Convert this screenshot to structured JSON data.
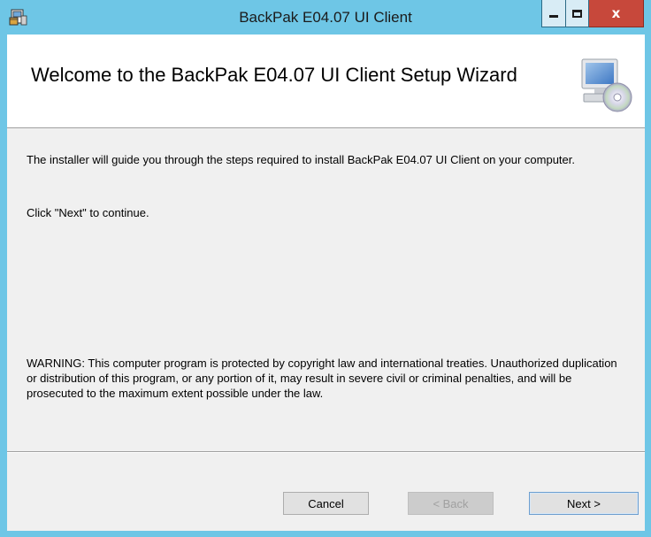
{
  "window": {
    "title": "BackPak E04.07 UI Client",
    "controls": {
      "close_glyph": "x"
    }
  },
  "banner": {
    "title": "Welcome to the BackPak E04.07 UI Client Setup Wizard",
    "icon": "computer-cd-icon"
  },
  "content": {
    "intro": "The installer will guide you through the steps required to install BackPak E04.07 UI Client on your computer.",
    "click_next": "Click \"Next\" to continue.",
    "warning": "WARNING: This computer program is protected by copyright law and international treaties. Unauthorized duplication or distribution of this program, or any portion of it, may result in severe civil or criminal penalties, and will be prosecuted to the maximum extent possible under the law."
  },
  "buttons": {
    "cancel": "Cancel",
    "back": "< Back",
    "next": "Next >"
  },
  "colors": {
    "titlebar": "#6ec6e6",
    "close_button": "#c7483b",
    "dialog_background": "#f0f0f0",
    "banner_background": "#ffffff"
  }
}
